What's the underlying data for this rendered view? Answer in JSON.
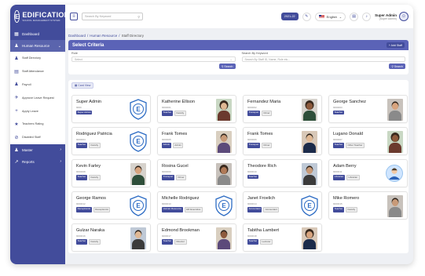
{
  "sidebar": {
    "brand": {
      "name": "EDIFICATION",
      "tagline": "SCHOOL MANAGEMENT SYSTEM"
    },
    "items": [
      {
        "label": "Dashboard",
        "icon": "dashboard-icon"
      },
      {
        "label": "Human Resource",
        "icon": "people-icon",
        "active": true
      },
      {
        "label": "Master",
        "icon": "user-icon"
      },
      {
        "label": "Reports",
        "icon": "chart-icon"
      }
    ],
    "submenu": [
      {
        "label": "Staff Directory",
        "icon": "people-icon"
      },
      {
        "label": "Staff Attendance",
        "icon": "calendar-icon"
      },
      {
        "label": "Payroll",
        "icon": "people-icon"
      },
      {
        "label": "Approve Leave Request",
        "icon": "airplane-icon"
      },
      {
        "label": "Apply Leave",
        "icon": "plus-icon"
      },
      {
        "label": "Teachers Rating",
        "icon": "star-icon"
      },
      {
        "label": "Disabled Staff",
        "icon": "user-disabled-icon"
      }
    ]
  },
  "topbar": {
    "search_placeholder": "Search By Keyword",
    "session": "2021-22",
    "language": "English",
    "user_name": "Super Admin",
    "user_role": "(Super Admin)"
  },
  "breadcrumb": {
    "root": "Dashboard",
    "section": "Human Resource",
    "current": "Staff Directory"
  },
  "criteria": {
    "title": "Select Criteria",
    "add_button": "+ Add Staff",
    "role_label": "Role",
    "role_value": "Select",
    "keyword_label": "Search By Keyword",
    "keyword_placeholder": "Search By Staff ID, Name, Role etc...",
    "search_button": "Search"
  },
  "directory": {
    "tab_label": "Card View",
    "staff": [
      {
        "name": "Super Admin",
        "id": "9000",
        "role": "Super Admin",
        "dept": "",
        "photo": "logo"
      },
      {
        "name": "Katherine Ellison",
        "id": "9000001",
        "role": "Teacher",
        "dept": "Faculty",
        "photo": "woman"
      },
      {
        "name": "Fernandez Maria",
        "id": "9000002",
        "role": "Transport",
        "dept": "Driver",
        "photo": "woman"
      },
      {
        "name": "George Sanchez",
        "id": "9000003",
        "role": "Teacher",
        "dept": "",
        "photo": "man"
      },
      {
        "name": "Rodriguez Patricia",
        "id": "9000004",
        "role": "Teacher",
        "dept": "Faculty",
        "photo": "logo"
      },
      {
        "name": "Frank Tomes",
        "id": "9000005",
        "role": "Admin",
        "dept": "Admin",
        "photo": "man"
      },
      {
        "name": "Frank Tomes",
        "id": "9000006",
        "role": "Transport",
        "dept": "Driver",
        "photo": "man"
      },
      {
        "name": "Lugano Donald",
        "id": "9000007",
        "role": "Teacher",
        "dept": "Other Teacher",
        "photo": "woman"
      },
      {
        "name": "Kevin Farley",
        "id": "9000008",
        "role": "Teacher",
        "dept": "Faculty",
        "photo": "man"
      },
      {
        "name": "Rosina Gucel",
        "id": "9000009",
        "role": "Transport",
        "dept": "Driver",
        "photo": "woman"
      },
      {
        "name": "Theodore Rich",
        "id": "9000010",
        "role": "Teacher",
        "dept": "",
        "photo": "man"
      },
      {
        "name": "Adam Berry",
        "id": "9000011",
        "role": "Librarian",
        "dept": "Librarian",
        "photo": "round"
      },
      {
        "name": "George Ramos",
        "id": "9000012",
        "role": "Receptionist",
        "dept": "Receptionist",
        "photo": "logo"
      },
      {
        "name": "Michelle Rodriguez",
        "id": "9000013",
        "role": "Human Resource",
        "dept": "HR Executive",
        "photo": "logo"
      },
      {
        "name": "Janet Froelich",
        "id": "9000014",
        "role": "Accountant",
        "dept": "Accountant",
        "photo": "logo"
      },
      {
        "name": "Mike Romero",
        "id": "9000015",
        "role": "Teacher",
        "dept": "Faculty",
        "photo": "man"
      },
      {
        "name": "Gulzar Naraka",
        "id": "9000016",
        "role": "Teacher",
        "dept": "Faculty",
        "photo": "man"
      },
      {
        "name": "Edmond Brookman",
        "id": "9000017",
        "role": "Teacher",
        "dept": "Director",
        "photo": "man"
      },
      {
        "name": "Tabitha Lambert",
        "id": "9000018",
        "role": "Teacher",
        "dept": "Lecturer",
        "photo": "woman"
      }
    ]
  },
  "colors": {
    "primary": "#424c9b",
    "header": "#5b63b7"
  }
}
